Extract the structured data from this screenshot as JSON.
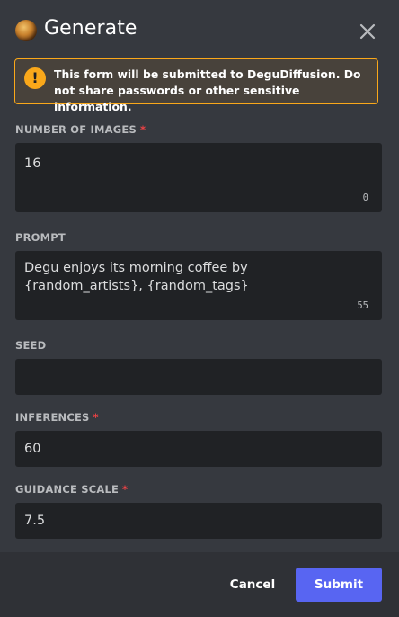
{
  "header": {
    "title": "Generate",
    "icon": "degu-app-icon",
    "close_icon": "close-icon"
  },
  "warning": {
    "prefix": "This form will be submitted to ",
    "app_name": "DeguDiffusion",
    "suffix": ". Do not share passwords or other sensitive information."
  },
  "fields": {
    "num_images": {
      "label": "NUMBER OF IMAGES",
      "required": "*",
      "value": "16",
      "counter": "0"
    },
    "prompt": {
      "label": "PROMPT",
      "value": "Degu enjoys its morning coffee by {random_artists}, {random_tags}",
      "counter": "55"
    },
    "seed": {
      "label": "SEED",
      "value": ""
    },
    "inferences": {
      "label": "INFERENCES",
      "required": "*",
      "value": "60"
    },
    "guidance": {
      "label": "GUIDANCE SCALE",
      "required": "*",
      "value": "7.5"
    }
  },
  "footer": {
    "cancel_label": "Cancel",
    "submit_label": "Submit"
  },
  "colors": {
    "background": "#36393f",
    "field_bg": "#202225",
    "footer_bg": "#2f3136",
    "accent": "#5865f2",
    "warning": "#faa81a",
    "required": "#ed4245"
  }
}
